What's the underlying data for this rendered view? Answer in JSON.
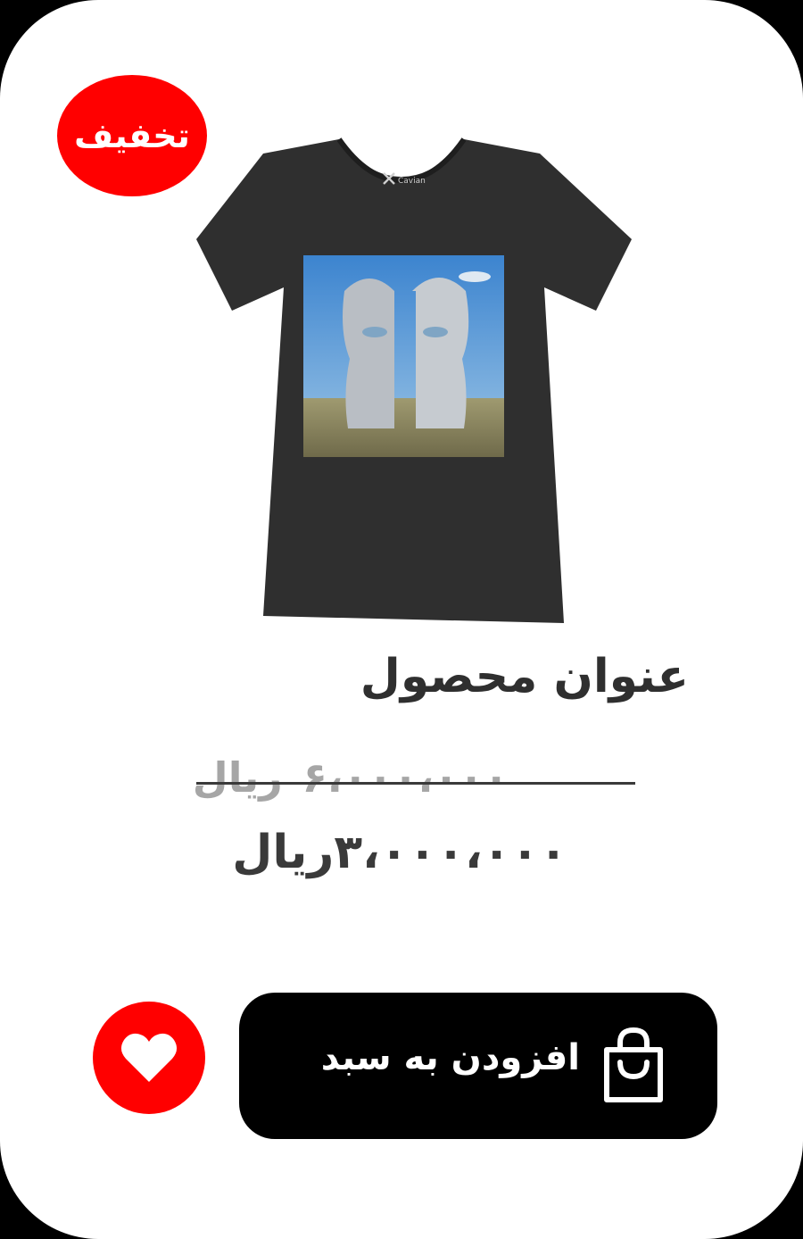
{
  "badge": {
    "label": "تخفیف"
  },
  "product": {
    "title": "عنوان محصول",
    "shirt_logo": "Cavian",
    "old_price": {
      "amount": "۶،۰۰۰،۰۰۰",
      "currency": "ریال"
    },
    "new_price": {
      "amount": "۳،۰۰۰،۰۰۰",
      "currency": "ریال"
    }
  },
  "actions": {
    "add_to_cart_label": "افزودن به سبد",
    "cart_icon": "shopping-bag-icon",
    "favorite_icon": "heart-icon"
  },
  "colors": {
    "accent": "#ff0000",
    "button_bg": "#000000",
    "shirt": "#2f2f2f",
    "title_text": "#2f2f2f",
    "old_price_text": "#a6a6a6"
  }
}
